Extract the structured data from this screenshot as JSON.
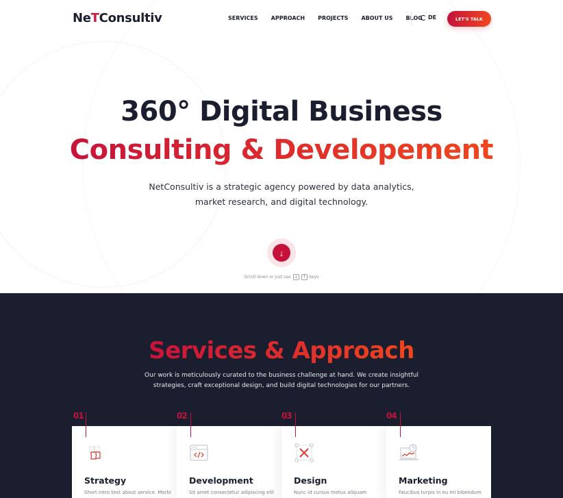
{
  "nav": {
    "logo_pre": "Ne",
    "logo_t": "T",
    "logo_post": "Consultiv",
    "links": [
      "SERVICES",
      "APPROACH",
      "PROJECTS",
      "ABOUT US",
      "BLOG"
    ],
    "language": "DE",
    "cta_label": "LET'S TALK"
  },
  "hero": {
    "title_line1": "360° Digital Business",
    "title_line2": "Consulting & Developement",
    "subtitle_line1": "NetConsultiv is a strategic agency powered by data analytics,",
    "subtitle_line2": "market research, and digital technology.",
    "scroll_icon": "arrow-down",
    "scroll_hint_pre": "Scroll down or just use",
    "key_down": "↓",
    "key_up": "↑",
    "scroll_hint_post": "keys"
  },
  "services": {
    "title": "Services & Approach",
    "subtitle_line1": "Our work is meticulously curated to the business challenge at hand. We create insightful",
    "subtitle_line2": "strategies, craft exceptional design, and build digital technologies for our partners.",
    "cards": [
      {
        "num": "01",
        "title": "Strategy",
        "text": "Short intro text about service. Morbi",
        "icon": "puzzle-icon"
      },
      {
        "num": "02",
        "title": "Development",
        "text": "Sit amet consectetur adipiscing elit",
        "icon": "code-window-icon"
      },
      {
        "num": "03",
        "title": "Design",
        "text": "Nunc id cursus metus aliquam",
        "icon": "design-tools-icon"
      },
      {
        "num": "04",
        "title": "Marketing",
        "text": "Faucibus turpis in eu mi bibendum",
        "icon": "analytics-laptop-icon"
      }
    ]
  },
  "colors": {
    "accent": "#c4123b",
    "accent_end": "#f0461f",
    "dark_bg": "#1a1e2f",
    "text_dark": "#1a1e2f"
  }
}
